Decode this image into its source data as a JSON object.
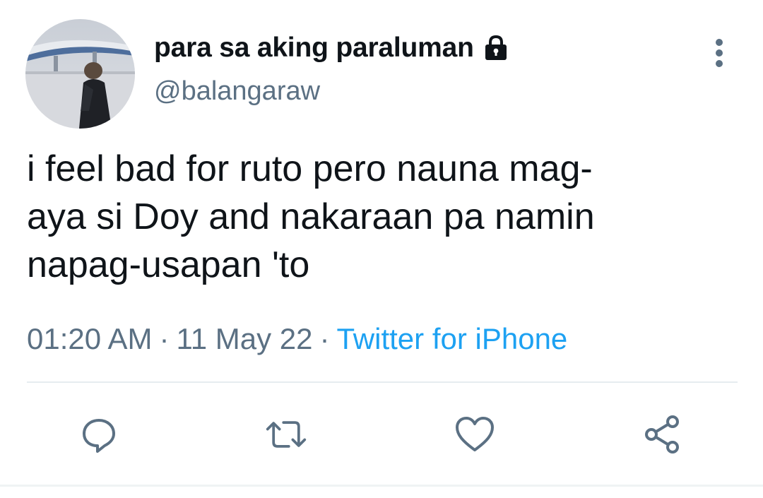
{
  "tweet": {
    "display_name": "para sa aking paraluman",
    "handle": "@balangaraw",
    "protected_icon": "lock-icon",
    "text_lines": [
      "i feel bad for ruto pero nauna mag-",
      "aya si Doy and nakaraan pa namin",
      "napag-usapan 'to"
    ],
    "time": "01:20 AM",
    "separator": "·",
    "date": "11 May 22",
    "source": "Twitter for iPhone"
  },
  "icons": {
    "more": "more-vertical-icon",
    "reply": "reply-icon",
    "retweet": "retweet-icon",
    "like": "heart-icon",
    "share": "share-icon"
  },
  "colors": {
    "text": "#0f1419",
    "secondary": "#5b7083",
    "accent": "#1da1f2",
    "icon": "#5b7083",
    "divider": "#e6ecf0"
  }
}
